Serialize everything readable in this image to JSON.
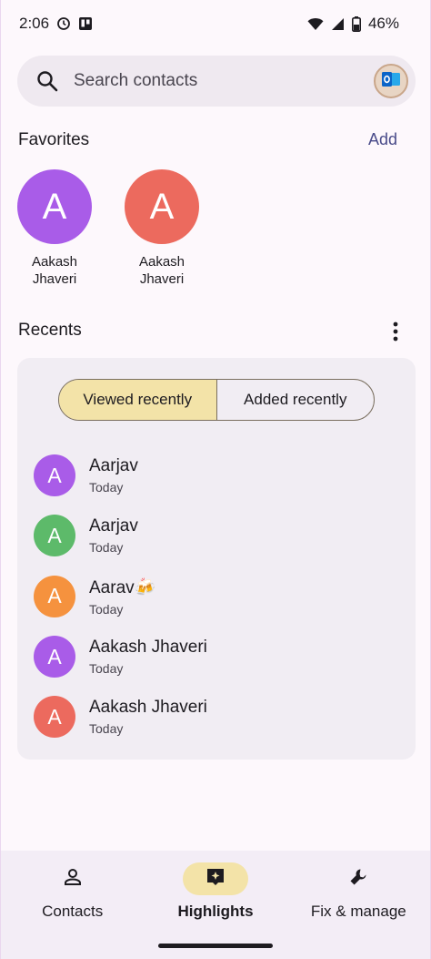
{
  "status_bar": {
    "time": "2:06",
    "battery": "46%",
    "icons": [
      "alarm-icon",
      "app-notification-icon",
      "wifi-icon",
      "signal-icon",
      "battery-icon"
    ]
  },
  "search": {
    "placeholder": "Search contacts",
    "icon": "search-icon",
    "account_avatar_icon": "outlook-icon"
  },
  "favorites": {
    "title": "Favorites",
    "add_label": "Add",
    "items": [
      {
        "initial": "A",
        "name_line1": "Aakash",
        "name_line2": "Jhaveri",
        "color": "#a95ce8"
      },
      {
        "initial": "A",
        "name_line1": "Aakash",
        "name_line2": "Jhaveri",
        "color": "#ec6a5e"
      }
    ]
  },
  "recents": {
    "title": "Recents",
    "tabs": [
      {
        "label": "Viewed recently",
        "active": true
      },
      {
        "label": "Added recently",
        "active": false
      }
    ],
    "items": [
      {
        "initial": "A",
        "name": "Aarjav",
        "sub": "Today",
        "color": "#a95ce8"
      },
      {
        "initial": "A",
        "name": "Aarjav",
        "sub": "Today",
        "color": "#5dba6a"
      },
      {
        "initial": "A",
        "name": "Aarav🍻",
        "sub": "Today",
        "color": "#f5923e"
      },
      {
        "initial": "A",
        "name": "Aakash Jhaveri",
        "sub": "Today",
        "color": "#a95ce8"
      },
      {
        "initial": "A",
        "name": "Aakash Jhaveri",
        "sub": "Today",
        "color": "#ec6a5e"
      }
    ]
  },
  "bottom_nav": {
    "items": [
      {
        "label": "Contacts",
        "icon": "person-icon",
        "active": false
      },
      {
        "label": "Highlights",
        "icon": "sparkle-icon",
        "active": true
      },
      {
        "label": "Fix & manage",
        "icon": "wrench-icon",
        "active": false
      }
    ]
  },
  "colors": {
    "accent": "#f3e3a8",
    "surface": "#f1edf3",
    "link": "#4a4c8a"
  }
}
